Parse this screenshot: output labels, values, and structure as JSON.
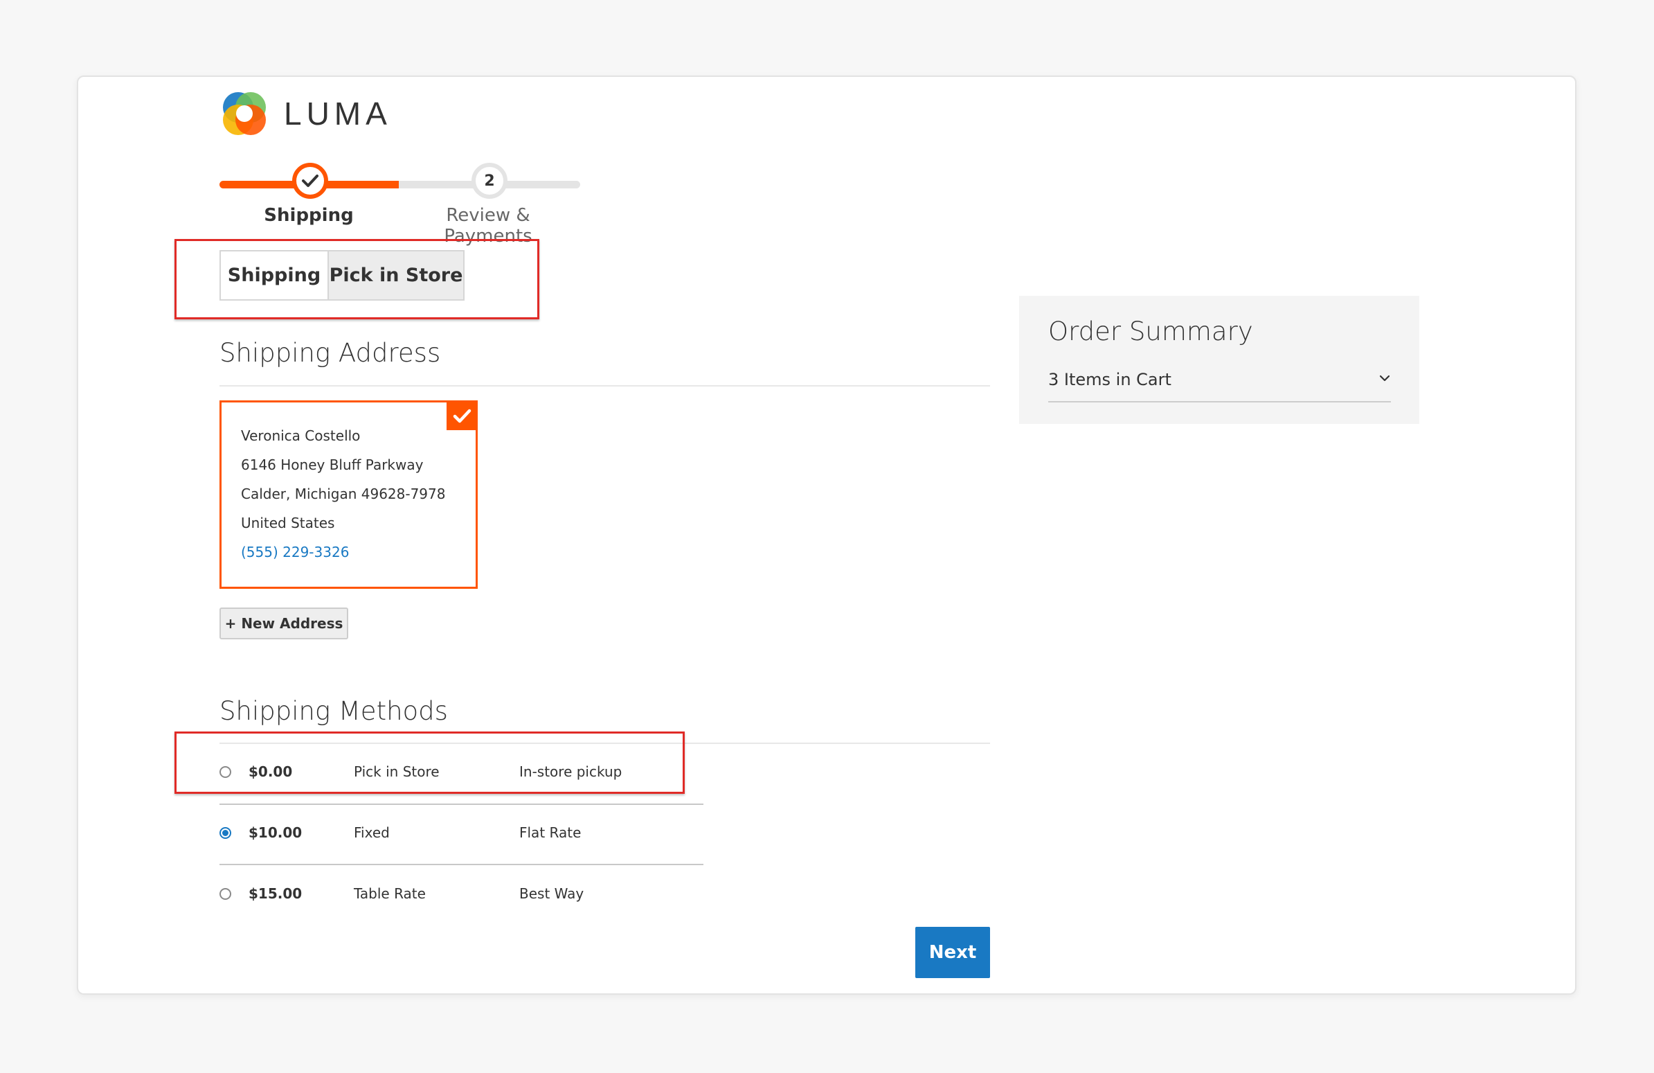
{
  "brand": {
    "name": "LUMA",
    "icon": "luma-logo-icon",
    "colors": [
      "#1979c3",
      "#6bbf59",
      "#f7b500",
      "#ff5501"
    ]
  },
  "progress": {
    "steps": [
      {
        "label": "Shipping",
        "state": "complete",
        "icon": "checkmark-icon"
      },
      {
        "label": "Review & Payments",
        "number": "2",
        "state": "pending"
      }
    ],
    "accent_color": "#ff5501"
  },
  "tabs": [
    {
      "label": "Shipping",
      "active": true
    },
    {
      "label": "Pick in Store",
      "active": false
    }
  ],
  "shipping_address": {
    "heading": "Shipping Address",
    "selected_address": {
      "name": "Veronica Costello",
      "street": "6146 Honey Bluff Parkway",
      "city_line": "Calder, Michigan 49628-7978",
      "country": "United States",
      "phone": "(555) 229-3326"
    },
    "new_address_label": "+ New Address"
  },
  "shipping_methods": {
    "heading": "Shipping Methods",
    "rows": [
      {
        "price": "$0.00",
        "method": "Pick in Store",
        "carrier": "In-store pickup",
        "selected": false
      },
      {
        "price": "$10.00",
        "method": "Fixed",
        "carrier": "Flat Rate",
        "selected": true
      },
      {
        "price": "$15.00",
        "method": "Table Rate",
        "carrier": "Best Way",
        "selected": false
      }
    ]
  },
  "actions": {
    "next_label": "Next"
  },
  "order_summary": {
    "title": "Order Summary",
    "items_label": "3 Items in Cart",
    "toggle_icon": "chevron-down-icon"
  },
  "annotations": {
    "highlight_color": "#e02b27"
  }
}
